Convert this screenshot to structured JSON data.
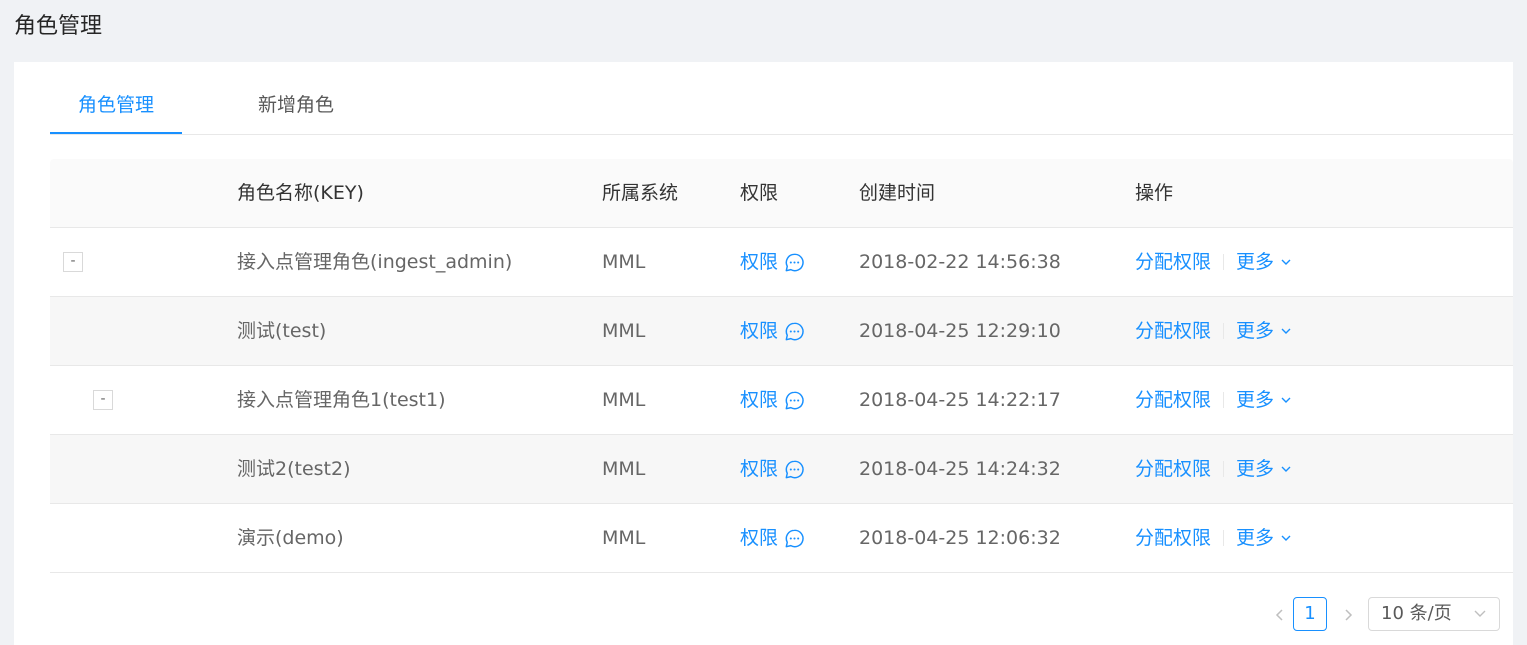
{
  "page_title": "角色管理",
  "tabs": [
    {
      "label": "角色管理",
      "active": true
    },
    {
      "label": "新增角色",
      "active": false
    }
  ],
  "table": {
    "columns": [
      "角色名称(KEY)",
      "所属系统",
      "权限",
      "创建时间",
      "操作"
    ],
    "rows": [
      {
        "name": "接入点管理角色(ingest_admin)",
        "system": "MML",
        "perm": "权限",
        "created": "2018-02-22 14:56:38",
        "assign": "分配权限",
        "more": "更多",
        "expander": "-"
      },
      {
        "name": "测试(test)",
        "system": "MML",
        "perm": "权限",
        "created": "2018-04-25 12:29:10",
        "assign": "分配权限",
        "more": "更多"
      },
      {
        "name": "接入点管理角色1(test1)",
        "system": "MML",
        "perm": "权限",
        "created": "2018-04-25 14:22:17",
        "assign": "分配权限",
        "more": "更多",
        "expander": "-"
      },
      {
        "name": "测试2(test2)",
        "system": "MML",
        "perm": "权限",
        "created": "2018-04-25 14:24:32",
        "assign": "分配权限",
        "more": "更多"
      },
      {
        "name": "演示(demo)",
        "system": "MML",
        "perm": "权限",
        "created": "2018-04-25 12:06:32",
        "assign": "分配权限",
        "more": "更多"
      }
    ]
  },
  "pagination": {
    "prev_icon": "chevron-left-icon",
    "current_page": "1",
    "next_icon": "chevron-right-icon",
    "page_size": "10 条/页"
  },
  "colors": {
    "accent": "#1890ff",
    "background": "#f0f2f5",
    "header_bg": "#fafafa",
    "alt_row_bg": "#f7f7f7"
  }
}
